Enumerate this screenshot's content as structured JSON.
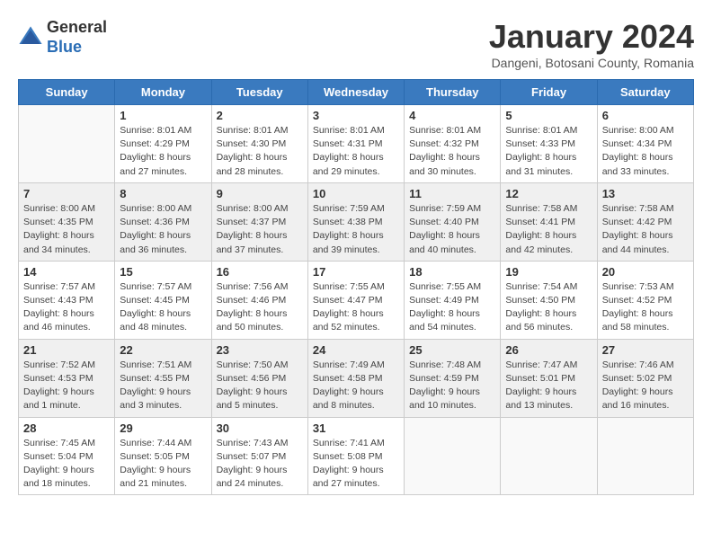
{
  "logo": {
    "general": "General",
    "blue": "Blue"
  },
  "title": "January 2024",
  "location": "Dangeni, Botosani County, Romania",
  "weekdays": [
    "Sunday",
    "Monday",
    "Tuesday",
    "Wednesday",
    "Thursday",
    "Friday",
    "Saturday"
  ],
  "weeks": [
    [
      {
        "day": "",
        "info": ""
      },
      {
        "day": "1",
        "info": "Sunrise: 8:01 AM\nSunset: 4:29 PM\nDaylight: 8 hours\nand 27 minutes."
      },
      {
        "day": "2",
        "info": "Sunrise: 8:01 AM\nSunset: 4:30 PM\nDaylight: 8 hours\nand 28 minutes."
      },
      {
        "day": "3",
        "info": "Sunrise: 8:01 AM\nSunset: 4:31 PM\nDaylight: 8 hours\nand 29 minutes."
      },
      {
        "day": "4",
        "info": "Sunrise: 8:01 AM\nSunset: 4:32 PM\nDaylight: 8 hours\nand 30 minutes."
      },
      {
        "day": "5",
        "info": "Sunrise: 8:01 AM\nSunset: 4:33 PM\nDaylight: 8 hours\nand 31 minutes."
      },
      {
        "day": "6",
        "info": "Sunrise: 8:00 AM\nSunset: 4:34 PM\nDaylight: 8 hours\nand 33 minutes."
      }
    ],
    [
      {
        "day": "7",
        "info": "Sunrise: 8:00 AM\nSunset: 4:35 PM\nDaylight: 8 hours\nand 34 minutes."
      },
      {
        "day": "8",
        "info": "Sunrise: 8:00 AM\nSunset: 4:36 PM\nDaylight: 8 hours\nand 36 minutes."
      },
      {
        "day": "9",
        "info": "Sunrise: 8:00 AM\nSunset: 4:37 PM\nDaylight: 8 hours\nand 37 minutes."
      },
      {
        "day": "10",
        "info": "Sunrise: 7:59 AM\nSunset: 4:38 PM\nDaylight: 8 hours\nand 39 minutes."
      },
      {
        "day": "11",
        "info": "Sunrise: 7:59 AM\nSunset: 4:40 PM\nDaylight: 8 hours\nand 40 minutes."
      },
      {
        "day": "12",
        "info": "Sunrise: 7:58 AM\nSunset: 4:41 PM\nDaylight: 8 hours\nand 42 minutes."
      },
      {
        "day": "13",
        "info": "Sunrise: 7:58 AM\nSunset: 4:42 PM\nDaylight: 8 hours\nand 44 minutes."
      }
    ],
    [
      {
        "day": "14",
        "info": "Sunrise: 7:57 AM\nSunset: 4:43 PM\nDaylight: 8 hours\nand 46 minutes."
      },
      {
        "day": "15",
        "info": "Sunrise: 7:57 AM\nSunset: 4:45 PM\nDaylight: 8 hours\nand 48 minutes."
      },
      {
        "day": "16",
        "info": "Sunrise: 7:56 AM\nSunset: 4:46 PM\nDaylight: 8 hours\nand 50 minutes."
      },
      {
        "day": "17",
        "info": "Sunrise: 7:55 AM\nSunset: 4:47 PM\nDaylight: 8 hours\nand 52 minutes."
      },
      {
        "day": "18",
        "info": "Sunrise: 7:55 AM\nSunset: 4:49 PM\nDaylight: 8 hours\nand 54 minutes."
      },
      {
        "day": "19",
        "info": "Sunrise: 7:54 AM\nSunset: 4:50 PM\nDaylight: 8 hours\nand 56 minutes."
      },
      {
        "day": "20",
        "info": "Sunrise: 7:53 AM\nSunset: 4:52 PM\nDaylight: 8 hours\nand 58 minutes."
      }
    ],
    [
      {
        "day": "21",
        "info": "Sunrise: 7:52 AM\nSunset: 4:53 PM\nDaylight: 9 hours\nand 1 minute."
      },
      {
        "day": "22",
        "info": "Sunrise: 7:51 AM\nSunset: 4:55 PM\nDaylight: 9 hours\nand 3 minutes."
      },
      {
        "day": "23",
        "info": "Sunrise: 7:50 AM\nSunset: 4:56 PM\nDaylight: 9 hours\nand 5 minutes."
      },
      {
        "day": "24",
        "info": "Sunrise: 7:49 AM\nSunset: 4:58 PM\nDaylight: 9 hours\nand 8 minutes."
      },
      {
        "day": "25",
        "info": "Sunrise: 7:48 AM\nSunset: 4:59 PM\nDaylight: 9 hours\nand 10 minutes."
      },
      {
        "day": "26",
        "info": "Sunrise: 7:47 AM\nSunset: 5:01 PM\nDaylight: 9 hours\nand 13 minutes."
      },
      {
        "day": "27",
        "info": "Sunrise: 7:46 AM\nSunset: 5:02 PM\nDaylight: 9 hours\nand 16 minutes."
      }
    ],
    [
      {
        "day": "28",
        "info": "Sunrise: 7:45 AM\nSunset: 5:04 PM\nDaylight: 9 hours\nand 18 minutes."
      },
      {
        "day": "29",
        "info": "Sunrise: 7:44 AM\nSunset: 5:05 PM\nDaylight: 9 hours\nand 21 minutes."
      },
      {
        "day": "30",
        "info": "Sunrise: 7:43 AM\nSunset: 5:07 PM\nDaylight: 9 hours\nand 24 minutes."
      },
      {
        "day": "31",
        "info": "Sunrise: 7:41 AM\nSunset: 5:08 PM\nDaylight: 9 hours\nand 27 minutes."
      },
      {
        "day": "",
        "info": ""
      },
      {
        "day": "",
        "info": ""
      },
      {
        "day": "",
        "info": ""
      }
    ]
  ]
}
